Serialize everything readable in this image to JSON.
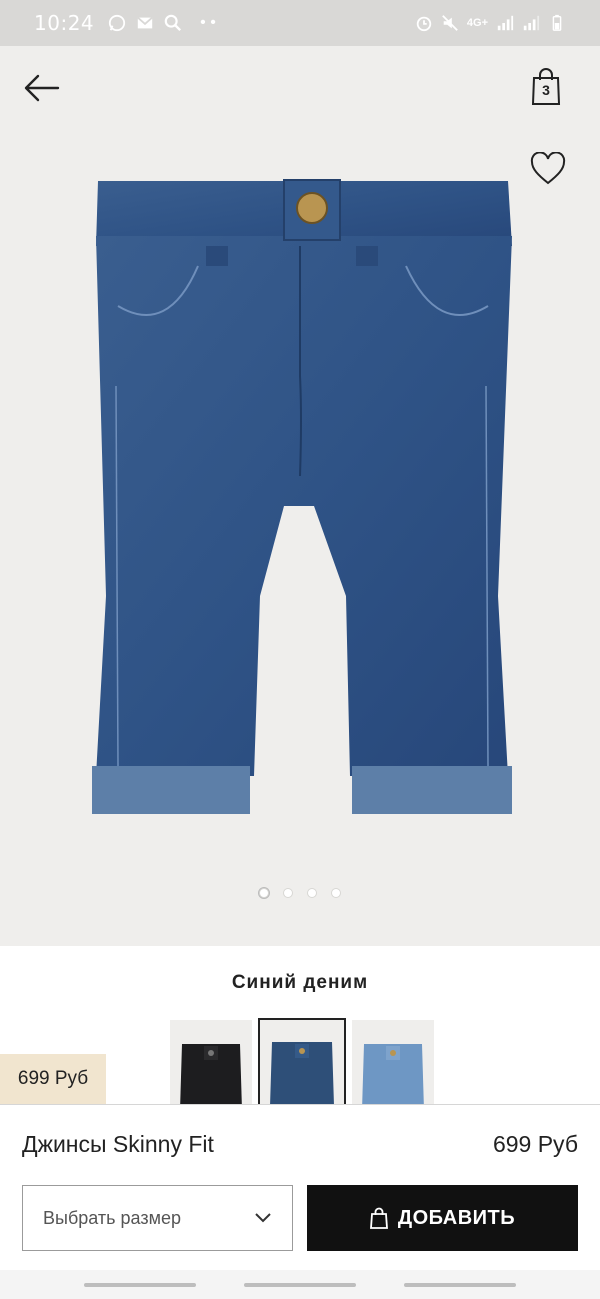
{
  "status_bar": {
    "time": "10:24",
    "network": "4G+"
  },
  "header": {
    "bag_count": "3"
  },
  "gallery": {
    "dots": 4,
    "active_dot": 0
  },
  "color": {
    "label": "Синий деним",
    "swatch_colors": [
      "#1d1d1f",
      "#2e4f78",
      "#6e97c4"
    ],
    "selected_index": 1
  },
  "sticky_price": "699 Руб",
  "product": {
    "title": "Джинсы Skinny Fit",
    "price": "699 Руб"
  },
  "actions": {
    "size_placeholder": "Выбрать размер",
    "add_label": "ДОБАВИТЬ"
  },
  "colors": {
    "accent_dark": "#111111",
    "badge_bg": "#f1e5cf"
  }
}
